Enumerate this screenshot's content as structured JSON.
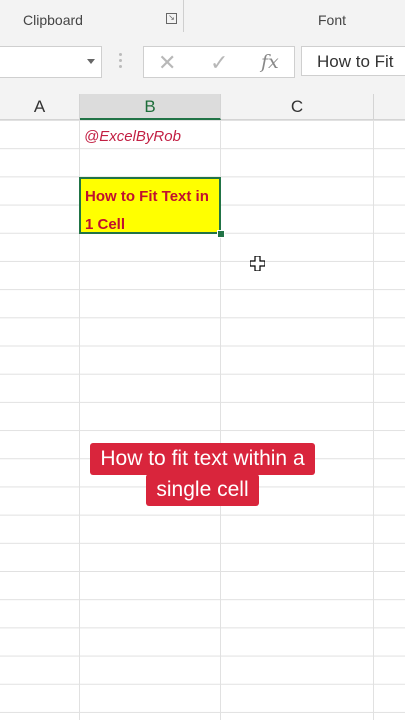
{
  "ribbon": {
    "clipboard_label": "Clipboard",
    "font_label": "Font",
    "launcher_icon": "dialog-launcher-icon"
  },
  "formula_bar": {
    "cancel_icon": "✕",
    "enter_icon": "✓",
    "fx_label": "fx",
    "content": "How to Fit"
  },
  "columns": [
    "A",
    "B",
    "C"
  ],
  "selected_column": "B",
  "cells": {
    "b1": "@ExcelByRob",
    "b3": "How to Fit Text in 1 Cell"
  },
  "caption": {
    "line1": "How to fit text within a",
    "line2": "single cell"
  },
  "colors": {
    "excel_green": "#217346",
    "cell_fill": "#ffff00",
    "cell_text": "#c01030",
    "caption_bg": "#d9253c"
  }
}
